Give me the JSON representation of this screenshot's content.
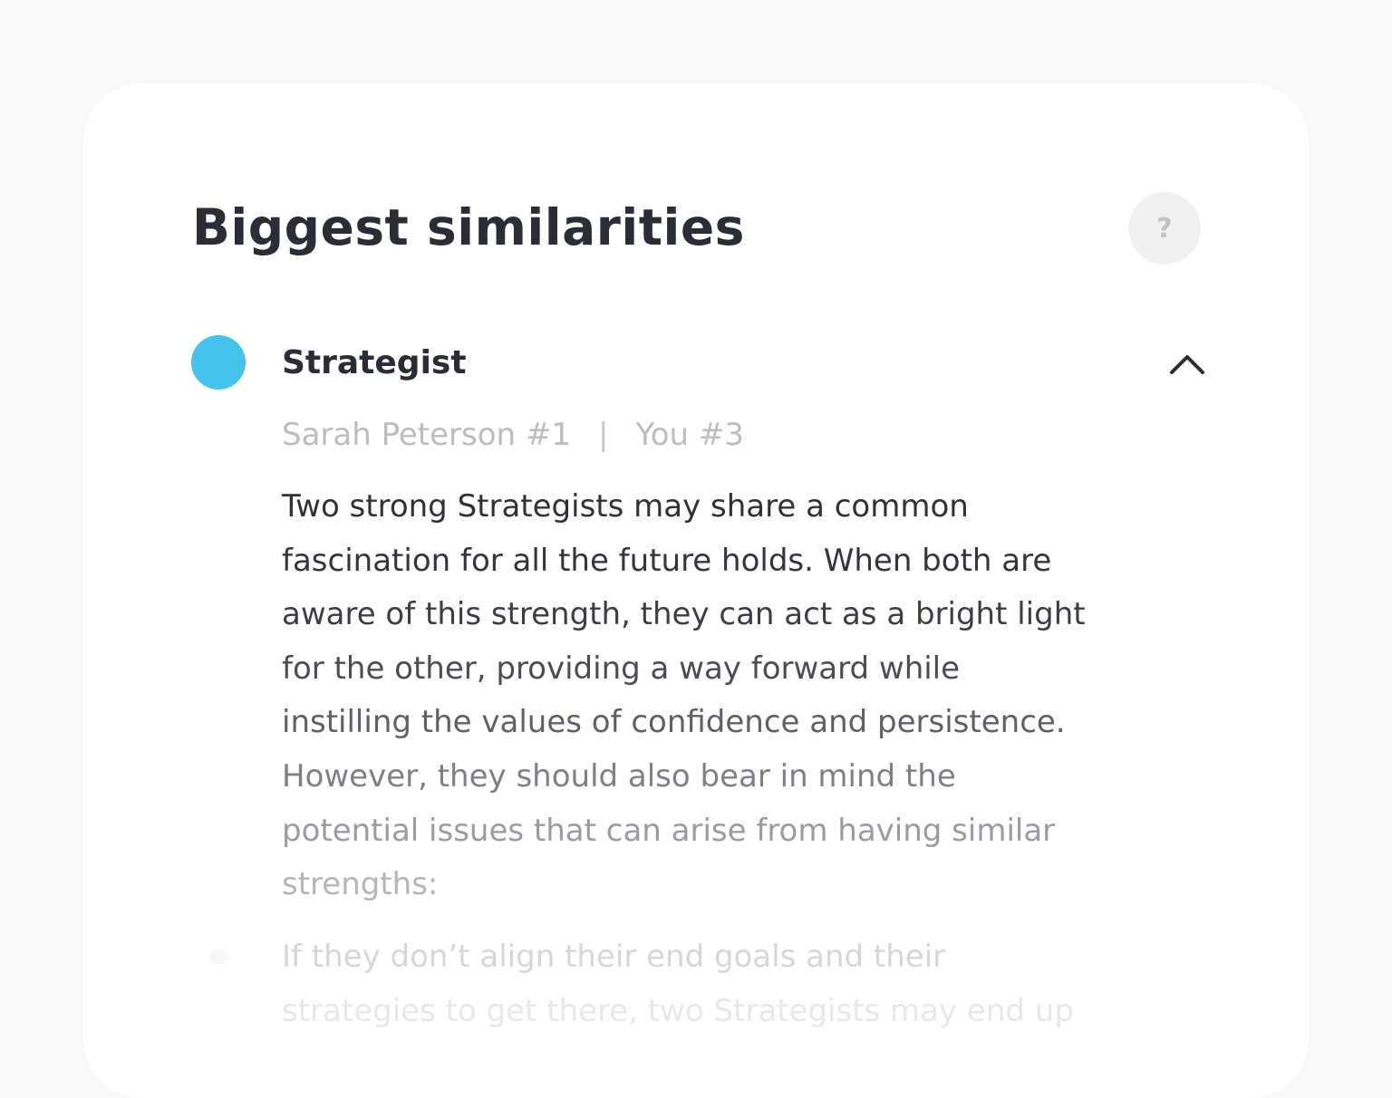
{
  "section": {
    "title": "Biggest similarities",
    "help_label": "?"
  },
  "item": {
    "title": "Strategist",
    "dot_color": "#45c2eb",
    "toggle_icon": "chevron-up-icon",
    "rank_other": "Sarah Peterson #1",
    "rank_separator": "|",
    "rank_you": "You #3",
    "paragraph_lines": [
      "Two strong Strategists may share a common",
      "fascination for all the future holds. When both are",
      "aware of this strength, they can act as a bright light",
      "for the other, providing a way forward while",
      "instilling the values of confidence and persistence.",
      "However, they should also bear in mind the",
      "potential issues that can arise from having similar",
      "strengths:"
    ],
    "bullet_lines": [
      "If they don’t align their end goals and their",
      "strategies to get there, two Strategists may end up"
    ]
  }
}
